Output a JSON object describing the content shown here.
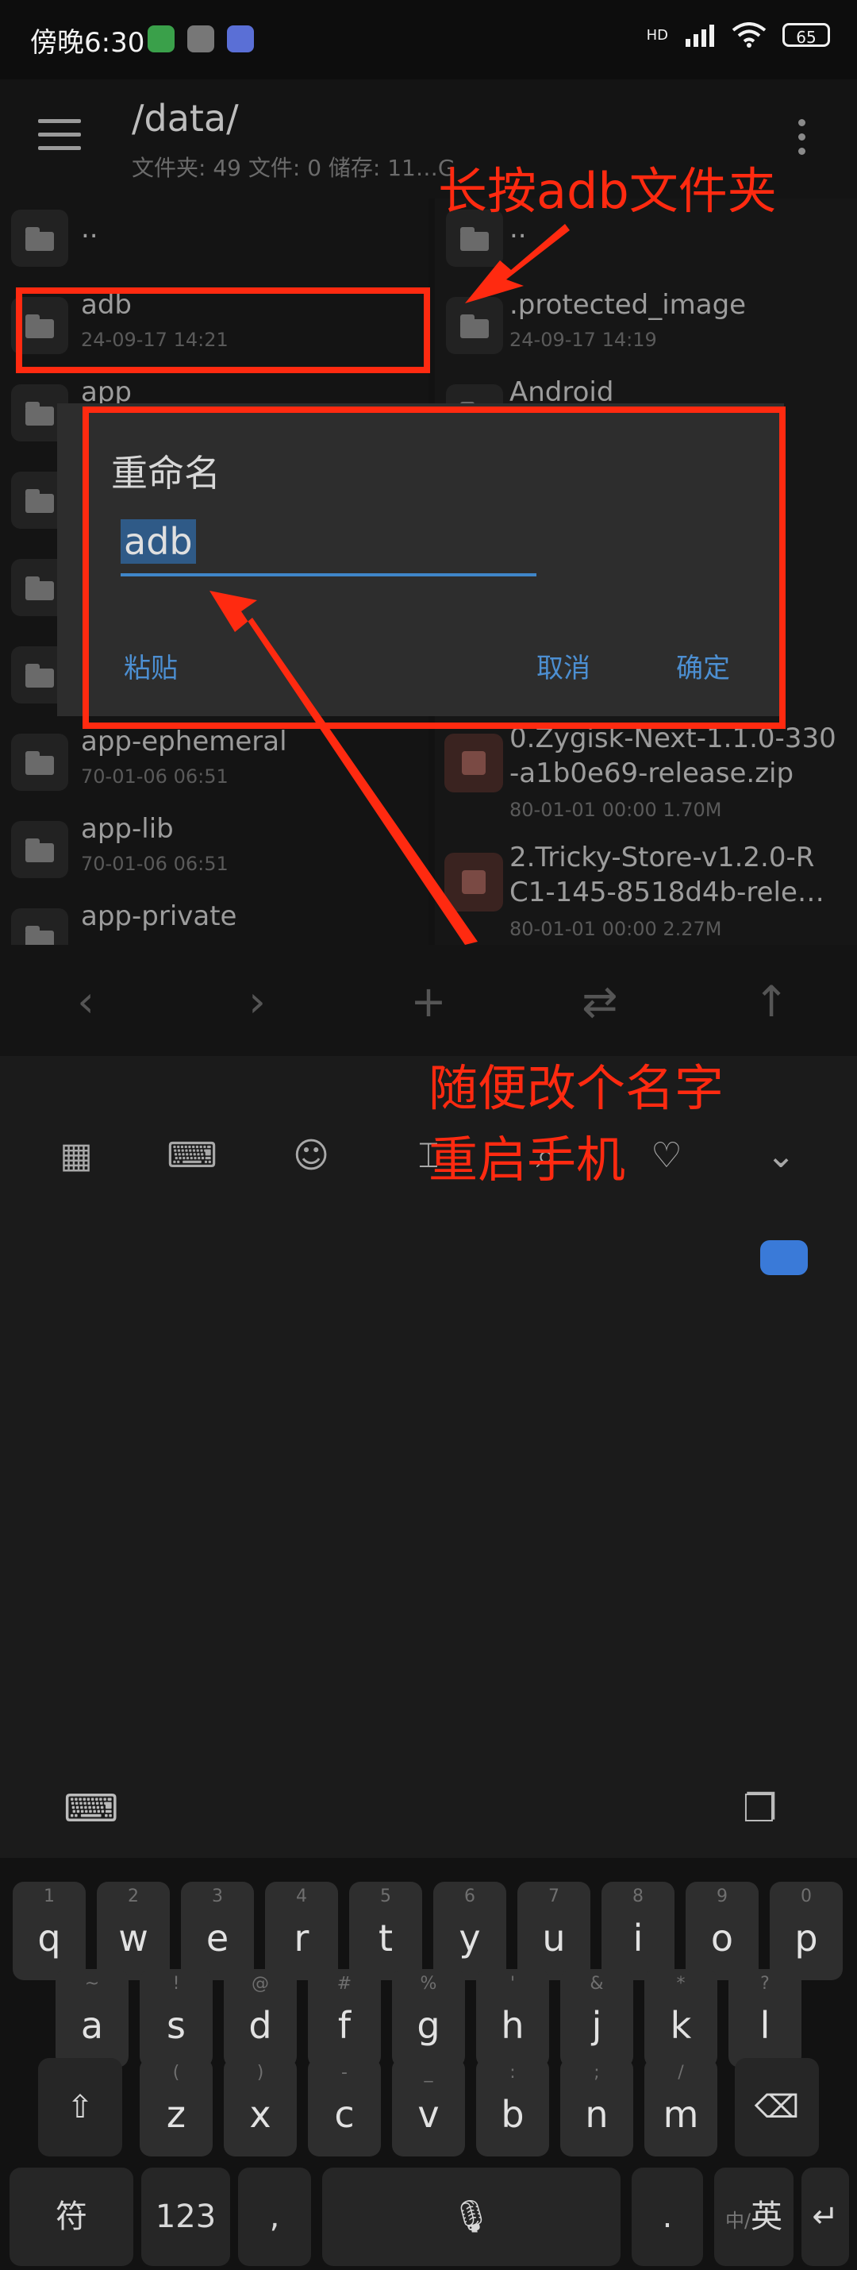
{
  "status_bar": {
    "time": "傍晚6:30",
    "network": "HD",
    "battery": "65"
  },
  "toolbar": {
    "path": "/data/",
    "stats": "文件夹: 49  文件: 0  储存: 11…G"
  },
  "left_list": [
    {
      "name": "..",
      "meta": ""
    },
    {
      "name": "adb",
      "meta": "24-09-17 14:21"
    },
    {
      "name": "app",
      "meta": ""
    },
    {
      "name": "",
      "meta": ""
    },
    {
      "name": "",
      "meta": ""
    },
    {
      "name": "",
      "meta": ""
    },
    {
      "name": "app-ephemeral",
      "meta": "70-01-06 06:51"
    },
    {
      "name": "app-lib",
      "meta": "70-01-06 06:51"
    },
    {
      "name": "app-private",
      "meta": ""
    }
  ],
  "right_list": [
    {
      "name": "..",
      "meta": ""
    },
    {
      "name": ".protected_image",
      "meta": "24-09-17 14:19"
    },
    {
      "name": "Android",
      "meta": ""
    },
    {
      "name_line1": "0.Zygisk-Next-1.1.0-330",
      "name_line2": "-a1b0e69-release.zip",
      "meta": "80-01-01 00:00  1.70M"
    },
    {
      "name_line1": "2.Tricky-Store-v1.2.0-R",
      "name_line2": "C1-145-8518d4b-rele…",
      "meta": "80-01-01 00:00  2.27M"
    }
  ],
  "dialog": {
    "title": "重命名",
    "input_value": "adb",
    "paste": "粘贴",
    "cancel": "取消",
    "ok": "确定"
  },
  "annotations": {
    "top": "长按adb文件夹",
    "bottom_line1": "随便改个名字",
    "bottom_line2": "重启手机"
  },
  "keyboard": {
    "row1": [
      [
        "1",
        "q"
      ],
      [
        "2",
        "w"
      ],
      [
        "3",
        "e"
      ],
      [
        "4",
        "r"
      ],
      [
        "5",
        "t"
      ],
      [
        "6",
        "y"
      ],
      [
        "7",
        "u"
      ],
      [
        "8",
        "i"
      ],
      [
        "9",
        "o"
      ],
      [
        "0",
        "p"
      ]
    ],
    "row2": [
      [
        "~",
        "a"
      ],
      [
        "!",
        "s"
      ],
      [
        "@",
        "d"
      ],
      [
        "#",
        "f"
      ],
      [
        "%",
        "g"
      ],
      [
        "'",
        "h"
      ],
      [
        "&",
        "j"
      ],
      [
        "*",
        "k"
      ],
      [
        "?",
        "l"
      ]
    ],
    "row3": [
      [
        "(",
        "z"
      ],
      [
        ")",
        "x"
      ],
      [
        "-",
        "c"
      ],
      [
        "_",
        "v"
      ],
      [
        ":",
        "b"
      ],
      [
        ";",
        "n"
      ],
      [
        "/",
        "m"
      ]
    ],
    "symbols": "符",
    "numbers": "123",
    "comma": ",",
    "period": ".",
    "lang_zh": "中/",
    "lang_en": "英"
  },
  "colors": {
    "annotation_red": "#ff2a10",
    "accent_blue": "#4c8fd2"
  }
}
